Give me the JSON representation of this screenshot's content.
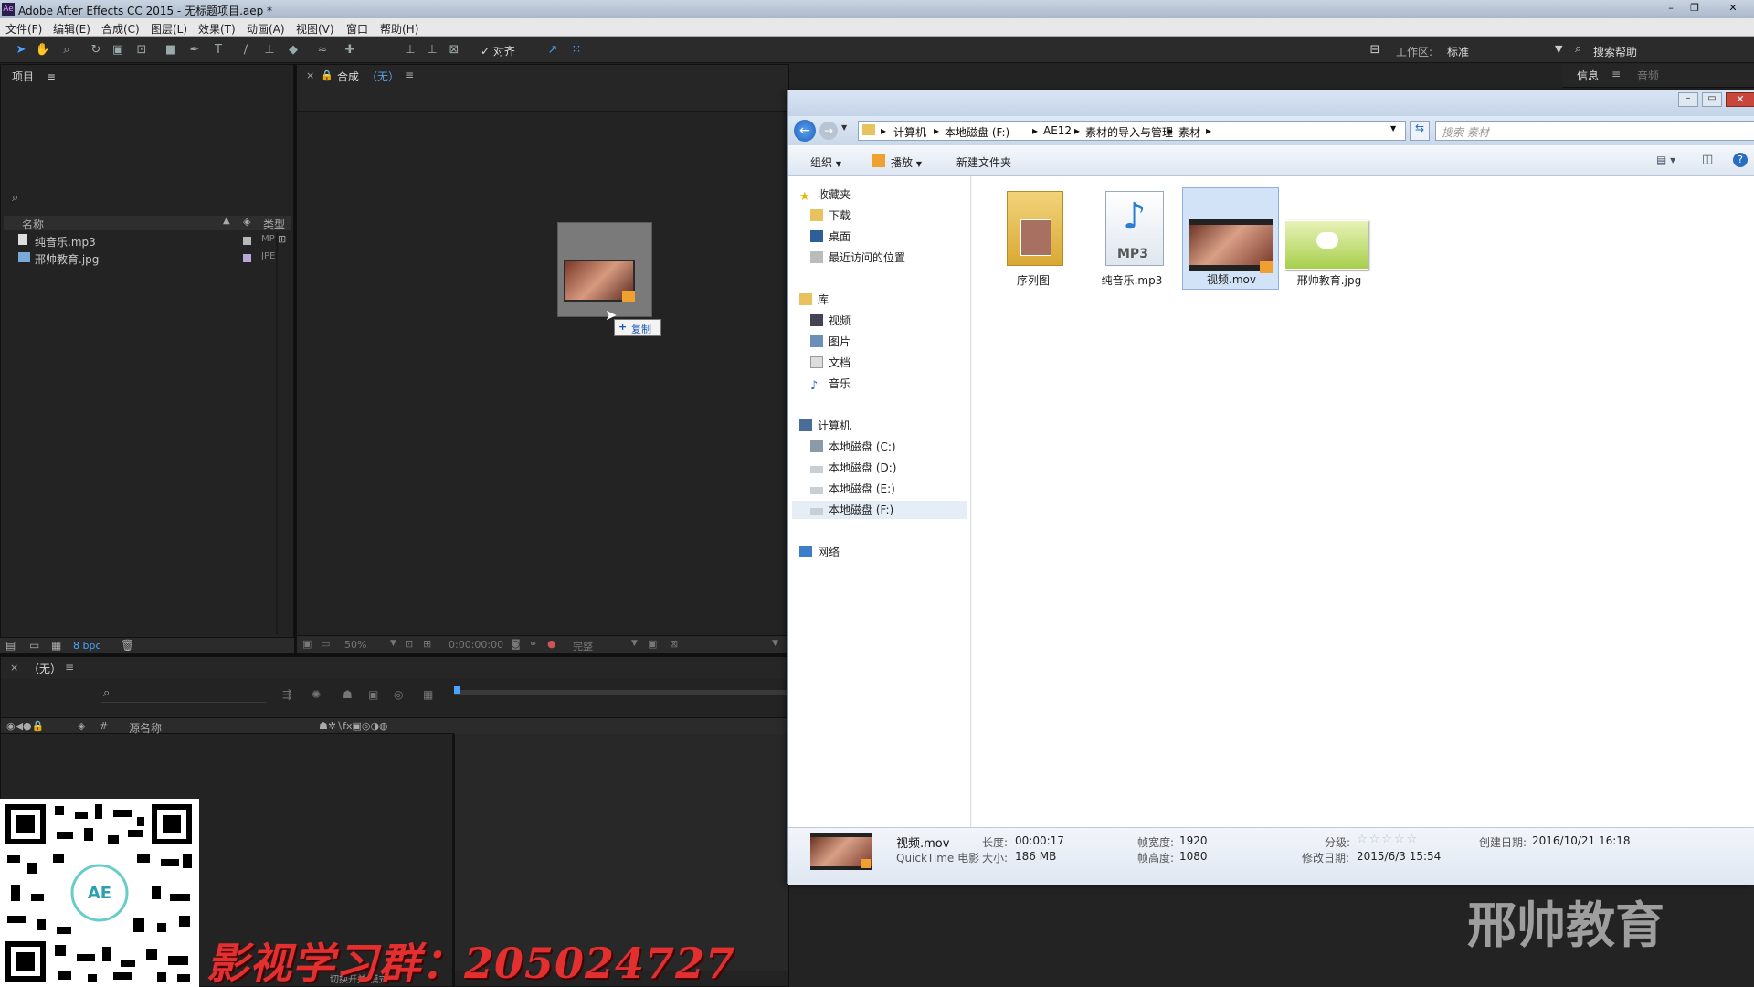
{
  "ae": {
    "title": "Adobe After Effects CC 2015 - 无标题项目.aep *",
    "logo_text": "Ae",
    "menu": [
      "文件(F)",
      "编辑(E)",
      "合成(C)",
      "图层(L)",
      "效果(T)",
      "动画(A)",
      "视图(V)",
      "窗口",
      "帮助(H)"
    ],
    "toolbar": {
      "snap_label": "对齐",
      "workspace_label": "工作区:",
      "workspace_value": "标准",
      "search_help_label": "搜索帮助"
    },
    "right_panel_tabs": [
      "信息",
      "音频"
    ],
    "project_panel": {
      "tab_label": "项目",
      "search_placeholder": "",
      "col_name": "名称",
      "col_type": "类型",
      "items": [
        {
          "name": "纯音乐.mp3",
          "type": "MP"
        },
        {
          "name": "邢帅教育.jpg",
          "type": "JPE"
        }
      ],
      "bpc_label": "8 bpc"
    },
    "comp_panel": {
      "tab_label": "合成",
      "tab_value": "（无）",
      "zoom": "50%",
      "timecode": "0:00:00:00",
      "quality": "完整",
      "drag_tip": "复制"
    },
    "timeline": {
      "tab_label": "（无）",
      "col_source_name": "源名称",
      "col_index": "#",
      "bottom_label": "切换开关/模式"
    },
    "watermark_group_text": "影视学习群：205024727",
    "qr_badge": "AE",
    "brand_watermark": "邢帅教育"
  },
  "explorer": {
    "breadcrumb": [
      "计算机",
      "本地磁盘 (F:)",
      "AE12",
      "素材的导入与管理",
      "素材"
    ],
    "search_placeholder": "搜索 素材",
    "toolbar": {
      "organize": "组织",
      "play": "播放",
      "new_folder": "新建文件夹"
    },
    "nav": {
      "favorites": "收藏夹",
      "downloads": "下载",
      "desktop": "桌面",
      "recent": "最近访问的位置",
      "libraries": "库",
      "videos": "视频",
      "pictures": "图片",
      "documents": "文档",
      "music": "音乐",
      "computer": "计算机",
      "drive_c": "本地磁盘 (C:)",
      "drive_d": "本地磁盘 (D:)",
      "drive_e": "本地磁盘 (E:)",
      "drive_f": "本地磁盘 (F:)",
      "network": "网络"
    },
    "files": [
      {
        "name": "序列图",
        "icon": "folder-icon"
      },
      {
        "name": "纯音乐.mp3",
        "icon": "mp3-file-icon",
        "badge": "MP3"
      },
      {
        "name": "视频.mov",
        "icon": "video-thumbnail-icon"
      },
      {
        "name": "邢帅教育.jpg",
        "icon": "image-thumbnail-icon"
      }
    ],
    "details": {
      "file_name": "视频.mov",
      "file_type": "QuickTime 电影",
      "length_label": "长度:",
      "length_value": "00:00:17",
      "size_label": "大小:",
      "size_value": "186 MB",
      "frame_width_label": "帧宽度:",
      "frame_width_value": "1920",
      "frame_height_label": "帧高度:",
      "frame_height_value": "1080",
      "rating_label": "分级:",
      "rating_value": 0,
      "modified_label": "修改日期:",
      "modified_value": "2015/6/3 15:54",
      "created_label": "创建日期:",
      "created_value": "2016/10/21 16:18"
    }
  }
}
